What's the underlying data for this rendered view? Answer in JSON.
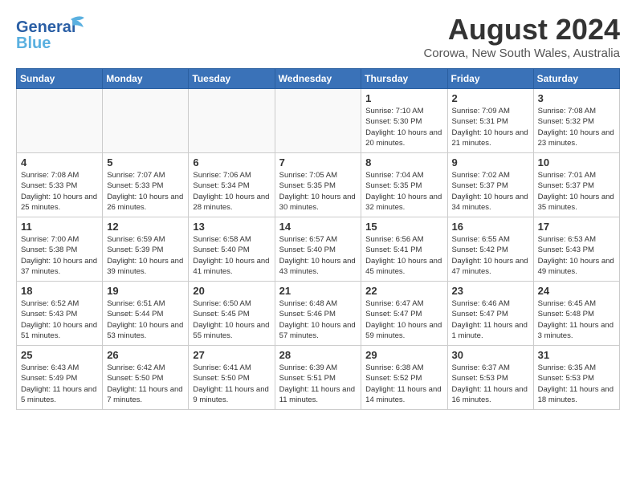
{
  "header": {
    "logo_line1": "General",
    "logo_line2": "Blue",
    "month_year": "August 2024",
    "location": "Corowa, New South Wales, Australia"
  },
  "days_of_week": [
    "Sunday",
    "Monday",
    "Tuesday",
    "Wednesday",
    "Thursday",
    "Friday",
    "Saturday"
  ],
  "weeks": [
    [
      {
        "day": "",
        "sunrise": "",
        "sunset": "",
        "daylight": ""
      },
      {
        "day": "",
        "sunrise": "",
        "sunset": "",
        "daylight": ""
      },
      {
        "day": "",
        "sunrise": "",
        "sunset": "",
        "daylight": ""
      },
      {
        "day": "",
        "sunrise": "",
        "sunset": "",
        "daylight": ""
      },
      {
        "day": "1",
        "sunrise": "7:10 AM",
        "sunset": "5:30 PM",
        "daylight": "10 hours and 20 minutes."
      },
      {
        "day": "2",
        "sunrise": "7:09 AM",
        "sunset": "5:31 PM",
        "daylight": "10 hours and 21 minutes."
      },
      {
        "day": "3",
        "sunrise": "7:08 AM",
        "sunset": "5:32 PM",
        "daylight": "10 hours and 23 minutes."
      }
    ],
    [
      {
        "day": "4",
        "sunrise": "7:08 AM",
        "sunset": "5:33 PM",
        "daylight": "10 hours and 25 minutes."
      },
      {
        "day": "5",
        "sunrise": "7:07 AM",
        "sunset": "5:33 PM",
        "daylight": "10 hours and 26 minutes."
      },
      {
        "day": "6",
        "sunrise": "7:06 AM",
        "sunset": "5:34 PM",
        "daylight": "10 hours and 28 minutes."
      },
      {
        "day": "7",
        "sunrise": "7:05 AM",
        "sunset": "5:35 PM",
        "daylight": "10 hours and 30 minutes."
      },
      {
        "day": "8",
        "sunrise": "7:04 AM",
        "sunset": "5:35 PM",
        "daylight": "10 hours and 32 minutes."
      },
      {
        "day": "9",
        "sunrise": "7:02 AM",
        "sunset": "5:37 PM",
        "daylight": "10 hours and 34 minutes."
      },
      {
        "day": "10",
        "sunrise": "7:01 AM",
        "sunset": "5:37 PM",
        "daylight": "10 hours and 35 minutes."
      }
    ],
    [
      {
        "day": "11",
        "sunrise": "7:00 AM",
        "sunset": "5:38 PM",
        "daylight": "10 hours and 37 minutes."
      },
      {
        "day": "12",
        "sunrise": "6:59 AM",
        "sunset": "5:39 PM",
        "daylight": "10 hours and 39 minutes."
      },
      {
        "day": "13",
        "sunrise": "6:58 AM",
        "sunset": "5:40 PM",
        "daylight": "10 hours and 41 minutes."
      },
      {
        "day": "14",
        "sunrise": "6:57 AM",
        "sunset": "5:40 PM",
        "daylight": "10 hours and 43 minutes."
      },
      {
        "day": "15",
        "sunrise": "6:56 AM",
        "sunset": "5:41 PM",
        "daylight": "10 hours and 45 minutes."
      },
      {
        "day": "16",
        "sunrise": "6:55 AM",
        "sunset": "5:42 PM",
        "daylight": "10 hours and 47 minutes."
      },
      {
        "day": "17",
        "sunrise": "6:53 AM",
        "sunset": "5:43 PM",
        "daylight": "10 hours and 49 minutes."
      }
    ],
    [
      {
        "day": "18",
        "sunrise": "6:52 AM",
        "sunset": "5:43 PM",
        "daylight": "10 hours and 51 minutes."
      },
      {
        "day": "19",
        "sunrise": "6:51 AM",
        "sunset": "5:44 PM",
        "daylight": "10 hours and 53 minutes."
      },
      {
        "day": "20",
        "sunrise": "6:50 AM",
        "sunset": "5:45 PM",
        "daylight": "10 hours and 55 minutes."
      },
      {
        "day": "21",
        "sunrise": "6:48 AM",
        "sunset": "5:46 PM",
        "daylight": "10 hours and 57 minutes."
      },
      {
        "day": "22",
        "sunrise": "6:47 AM",
        "sunset": "5:47 PM",
        "daylight": "10 hours and 59 minutes."
      },
      {
        "day": "23",
        "sunrise": "6:46 AM",
        "sunset": "5:47 PM",
        "daylight": "11 hours and 1 minute."
      },
      {
        "day": "24",
        "sunrise": "6:45 AM",
        "sunset": "5:48 PM",
        "daylight": "11 hours and 3 minutes."
      }
    ],
    [
      {
        "day": "25",
        "sunrise": "6:43 AM",
        "sunset": "5:49 PM",
        "daylight": "11 hours and 5 minutes."
      },
      {
        "day": "26",
        "sunrise": "6:42 AM",
        "sunset": "5:50 PM",
        "daylight": "11 hours and 7 minutes."
      },
      {
        "day": "27",
        "sunrise": "6:41 AM",
        "sunset": "5:50 PM",
        "daylight": "11 hours and 9 minutes."
      },
      {
        "day": "28",
        "sunrise": "6:39 AM",
        "sunset": "5:51 PM",
        "daylight": "11 hours and 11 minutes."
      },
      {
        "day": "29",
        "sunrise": "6:38 AM",
        "sunset": "5:52 PM",
        "daylight": "11 hours and 14 minutes."
      },
      {
        "day": "30",
        "sunrise": "6:37 AM",
        "sunset": "5:53 PM",
        "daylight": "11 hours and 16 minutes."
      },
      {
        "day": "31",
        "sunrise": "6:35 AM",
        "sunset": "5:53 PM",
        "daylight": "11 hours and 18 minutes."
      }
    ]
  ]
}
